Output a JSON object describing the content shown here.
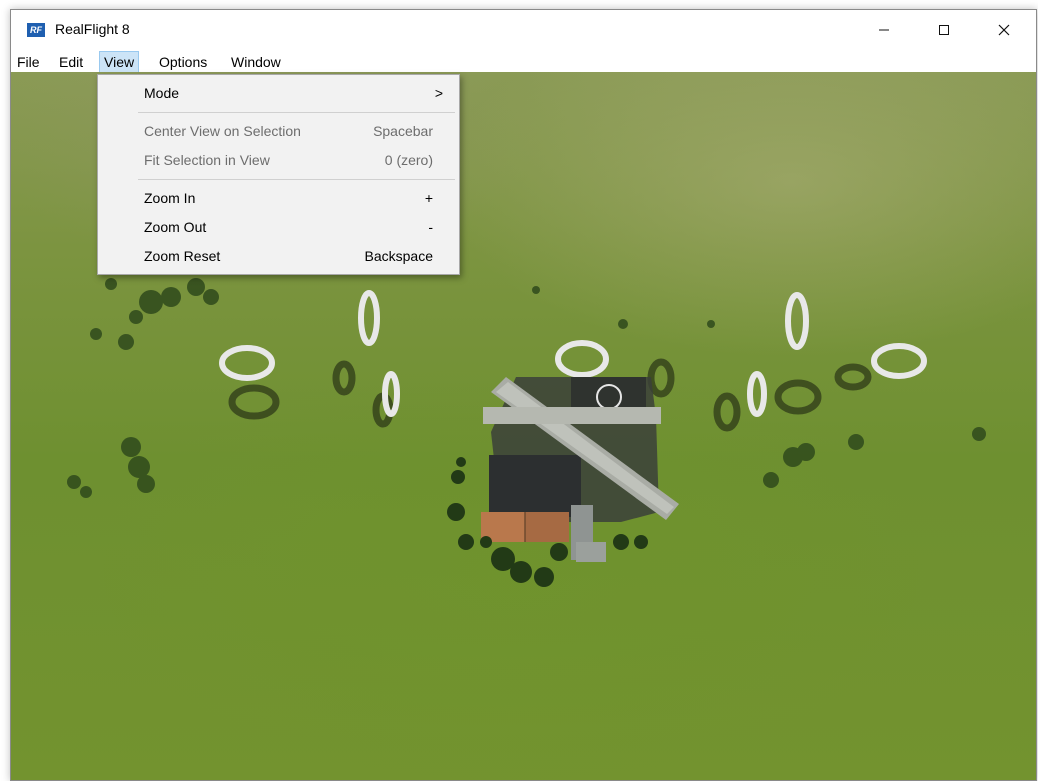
{
  "window": {
    "title": "RealFlight 8",
    "logo_text": "RF"
  },
  "controls": {
    "minimize_icon": "minimize-icon",
    "maximize_icon": "maximize-icon",
    "close_icon": "close-icon"
  },
  "menubar": [
    "File",
    "Edit",
    "View",
    "Options",
    "Window"
  ],
  "active_menu": "View",
  "view_menu": {
    "mode": {
      "label": "Mode",
      "submenu_arrow": ">"
    },
    "center_view": {
      "label": "Center View on Selection",
      "shortcut": "Spacebar",
      "disabled": true
    },
    "fit_selection": {
      "label": "Fit Selection in View",
      "shortcut": "0 (zero)",
      "disabled": true
    },
    "zoom_in": {
      "label": "Zoom In",
      "shortcut": "+"
    },
    "zoom_out": {
      "label": "Zoom Out",
      "shortcut": "-"
    },
    "zoom_reset": {
      "label": "Zoom Reset",
      "shortcut": "Backspace"
    }
  },
  "colors": {
    "logo": "#1f5fb0",
    "menu_highlight": "#cce4f7",
    "grass": "#73932f"
  }
}
